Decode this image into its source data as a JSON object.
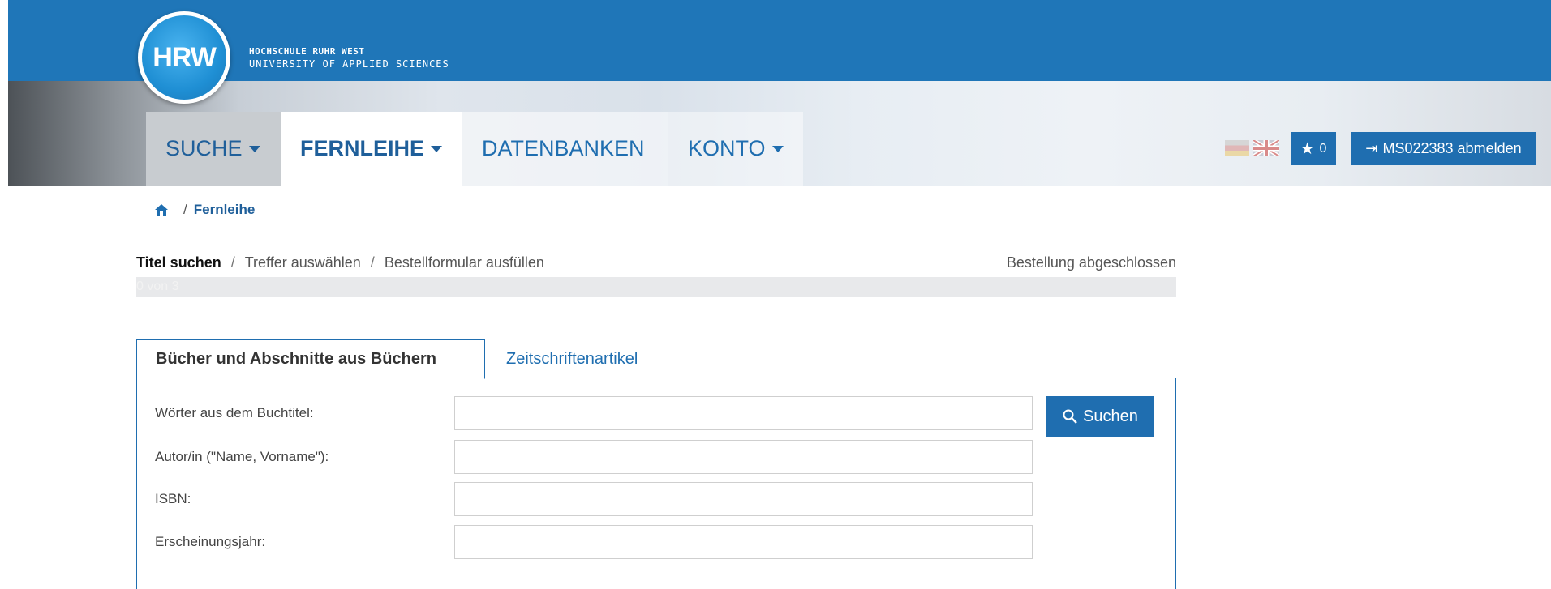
{
  "header": {
    "logo_text": "HRW",
    "brand_line1": "HOCHSCHULE RUHR WEST",
    "brand_line2": "UNIVERSITY OF APPLIED SCIENCES"
  },
  "nav": {
    "items": [
      {
        "label": "SUCHE",
        "dropdown": true
      },
      {
        "label": "FERNLEIHE",
        "dropdown": true,
        "active": true
      },
      {
        "label": "DATENBANKEN",
        "dropdown": false
      },
      {
        "label": "KONTO",
        "dropdown": true
      }
    ]
  },
  "toolbar": {
    "favorites_count": "0",
    "logout_label": "MS022383 abmelden"
  },
  "breadcrumb": {
    "current": "Fernleihe"
  },
  "steps": {
    "items": [
      "Titel suchen",
      "Treffer auswählen",
      "Bestellformular ausfüllen"
    ],
    "final": "Bestellung abgeschlossen",
    "progress_text": "0 von 3",
    "progress_fraction": 0
  },
  "tabs": {
    "books": "Bücher und Abschnitte aus Büchern",
    "articles": "Zeitschriftenartikel"
  },
  "form": {
    "fields": [
      {
        "label": "Wörter aus dem Buchtitel:",
        "value": ""
      },
      {
        "label": "Autor/in (\"Name, Vorname\"):",
        "value": ""
      },
      {
        "label": "ISBN:",
        "value": ""
      },
      {
        "label": "Erscheinungsjahr:",
        "value": ""
      }
    ],
    "search_label": "Suchen"
  },
  "colors": {
    "primary": "#1f6eb0",
    "header_blue": "#1f76b8"
  }
}
